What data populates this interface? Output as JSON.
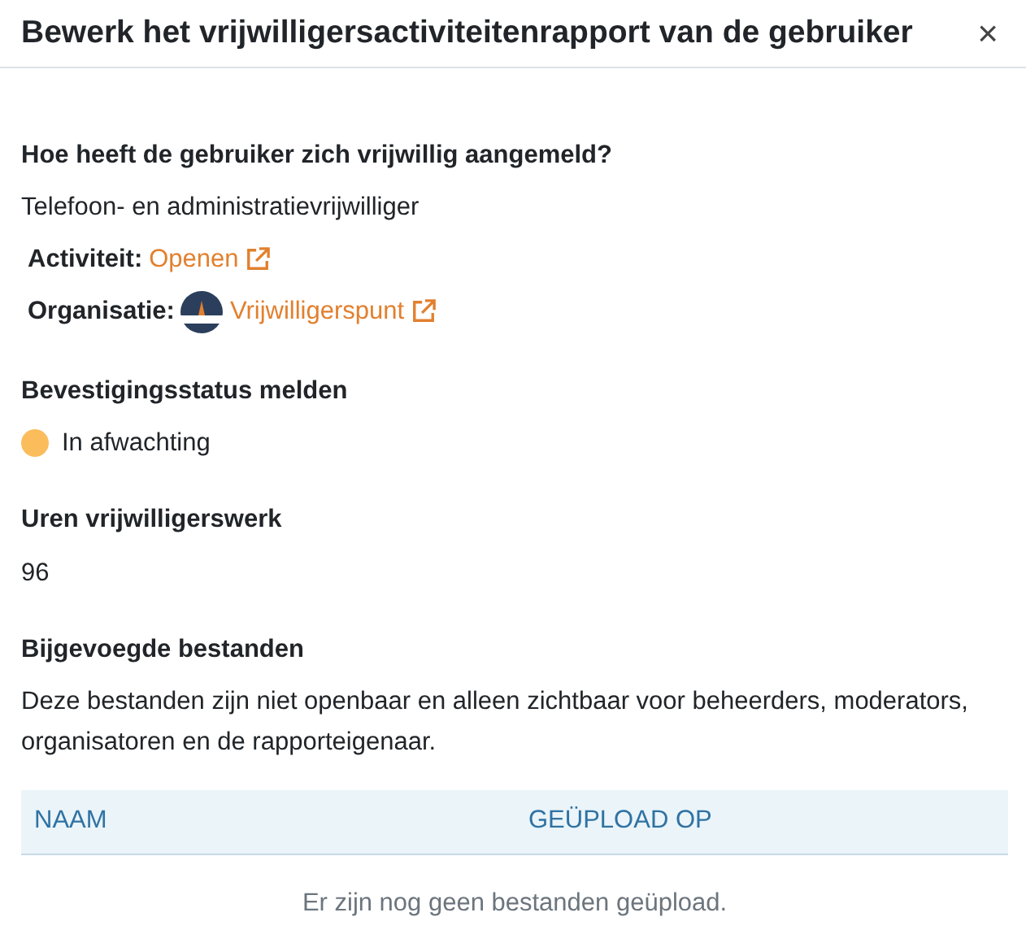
{
  "modal": {
    "title": "Bewerk het vrijwilligersactiviteitenrapport van de gebruiker",
    "close": "×"
  },
  "signup": {
    "heading": "Hoe heeft de gebruiker zich vrijwillig aangemeld?",
    "value": "Telefoon- en administratievrijwilliger",
    "activity": {
      "label": "Activiteit:",
      "link": "Openen"
    },
    "organisation": {
      "label": "Organisatie:",
      "link": "Vrijwilligerspunt"
    }
  },
  "status": {
    "heading": "Bevestigingsstatus melden",
    "label": "In afwachting",
    "color": "#fbbd5c"
  },
  "hours": {
    "heading": "Uren vrijwilligerswerk",
    "value": "96"
  },
  "files": {
    "heading": "Bijgevoegde bestanden",
    "note": "Deze bestanden zijn niet openbaar en alleen zichtbaar voor beheerders, moderators, organisatoren en de rapporteigenaar.",
    "columns": [
      "NAAM",
      "GEÜPLOAD OP"
    ],
    "empty": "Er zijn nog geen bestanden geüpload."
  }
}
